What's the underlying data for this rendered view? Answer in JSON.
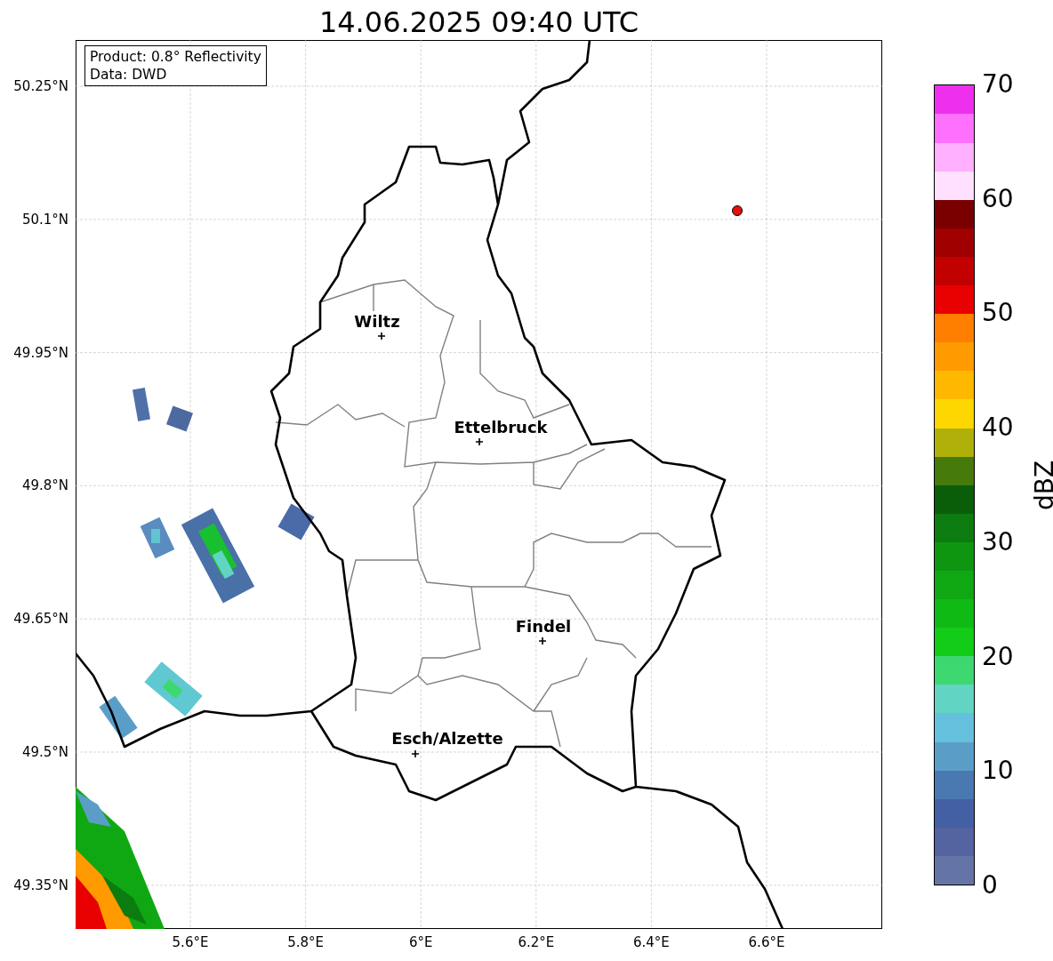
{
  "title": "14.06.2025 09:40 UTC",
  "info_box": {
    "lines": [
      "Product: 0.8° Reflectivity",
      "Data: DWD"
    ]
  },
  "map": {
    "yticks": [
      "50.25°N",
      "50.1°N",
      "49.95°N",
      "49.8°N",
      "49.65°N",
      "49.5°N",
      "49.35°N"
    ],
    "xticks": [
      "5.6°E",
      "5.8°E",
      "6°E",
      "6.2°E",
      "6.4°E",
      "6.6°E"
    ],
    "cities": [
      {
        "name": "Wiltz"
      },
      {
        "name": "Ettelbruck"
      },
      {
        "name": "Findel"
      },
      {
        "name": "Esch/Alzette"
      }
    ]
  },
  "colorbar": {
    "label": "dBZ",
    "ticks": [
      "70",
      "60",
      "50",
      "40",
      "30",
      "20",
      "10",
      "0"
    ],
    "segments": [
      {
        "color": "#6574a6"
      },
      {
        "color": "#5364a0"
      },
      {
        "color": "#4460a4"
      },
      {
        "color": "#4a78b0"
      },
      {
        "color": "#5a9ec8"
      },
      {
        "color": "#64c0dc"
      },
      {
        "color": "#62d4c4"
      },
      {
        "color": "#3ed870"
      },
      {
        "color": "#12cc18"
      },
      {
        "color": "#10ba14"
      },
      {
        "color": "#10a812"
      },
      {
        "color": "#0e9610"
      },
      {
        "color": "#0c7c10"
      },
      {
        "color": "#0a5e0a"
      },
      {
        "color": "#467a0a"
      },
      {
        "color": "#b0b00a"
      },
      {
        "color": "#ffd700"
      },
      {
        "color": "#ffb800"
      },
      {
        "color": "#ff9a00"
      },
      {
        "color": "#ff7e00"
      },
      {
        "color": "#e80000"
      },
      {
        "color": "#c20000"
      },
      {
        "color": "#a00000"
      },
      {
        "color": "#7a0000"
      },
      {
        "color": "#ffe0ff"
      },
      {
        "color": "#ffb0ff"
      },
      {
        "color": "#ff70ff"
      },
      {
        "color": "#ee30ee"
      }
    ]
  }
}
